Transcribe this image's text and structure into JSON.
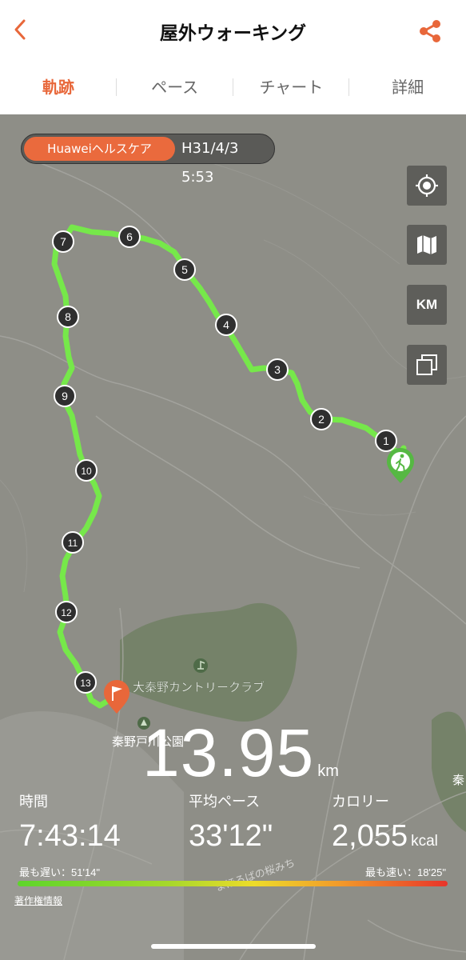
{
  "header": {
    "title": "屋外ウォーキング",
    "back_icon": "chevron-left-icon",
    "share_icon": "share-icon",
    "accent_color": "#e8673a"
  },
  "tabs": [
    {
      "label": "軌跡",
      "active": true
    },
    {
      "label": "ペース",
      "active": false
    },
    {
      "label": "チャート",
      "active": false
    },
    {
      "label": "詳細",
      "active": false
    }
  ],
  "source": {
    "tag": "Huaweiヘルスケア",
    "datetime": "H31/4/3 5:53"
  },
  "map_controls": [
    {
      "name": "locate-icon"
    },
    {
      "name": "map-type-icon"
    },
    {
      "name": "km-toggle",
      "label": "KM"
    },
    {
      "name": "layers-icon"
    }
  ],
  "map_labels": {
    "golf_club": "大秦野カントリークラブ",
    "park": "秦野戸川公園",
    "road": "まほろばの桜みち",
    "edge_label": "秦"
  },
  "km_markers": [
    "1",
    "2",
    "3",
    "4",
    "5",
    "6",
    "7",
    "8",
    "9",
    "10",
    "11",
    "12",
    "13"
  ],
  "summary": {
    "distance": "13.95",
    "distance_unit": "km",
    "time_label": "時間",
    "time_value": "7:43:14",
    "pace_label": "平均ペース",
    "pace_value": "33'12\"",
    "calorie_label": "カロリー",
    "calorie_value": "2,055",
    "calorie_unit": "kcal"
  },
  "pace_legend": {
    "slowest": "最も遅い：51'14\"",
    "fastest": "最も速い：18'25\""
  },
  "copyright": "著作権情報"
}
